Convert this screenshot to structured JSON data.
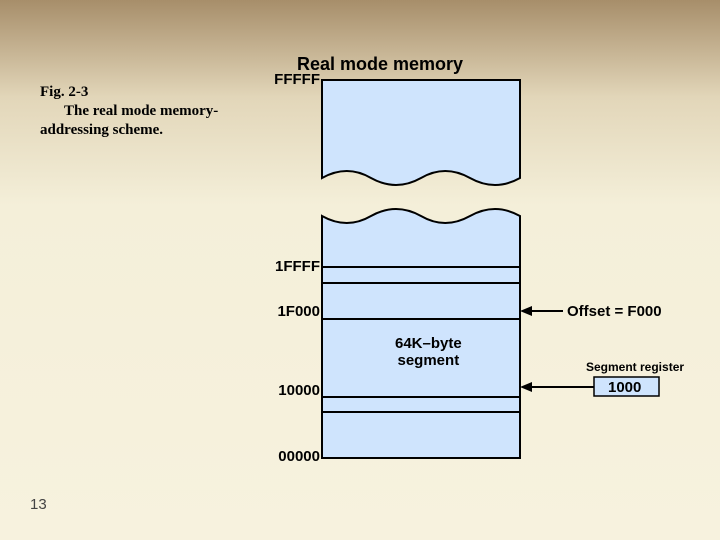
{
  "header": {
    "title": "Real mode memory"
  },
  "caption": {
    "line1": "Fig. 2-3",
    "line2": "The real mode memory-",
    "line3": "addressing scheme."
  },
  "addresses": {
    "top": "FFFFF",
    "seg_hi": "1FFFF",
    "offset": "1F000",
    "seg_lo": "10000",
    "bottom": "00000"
  },
  "labels": {
    "offset": "Offset = F000",
    "segment_block_line1": "64K–byte",
    "segment_block_line2": "segment",
    "seg_reg_caption": "Segment register",
    "seg_reg_value": "1000"
  },
  "slide": {
    "number": "13"
  }
}
